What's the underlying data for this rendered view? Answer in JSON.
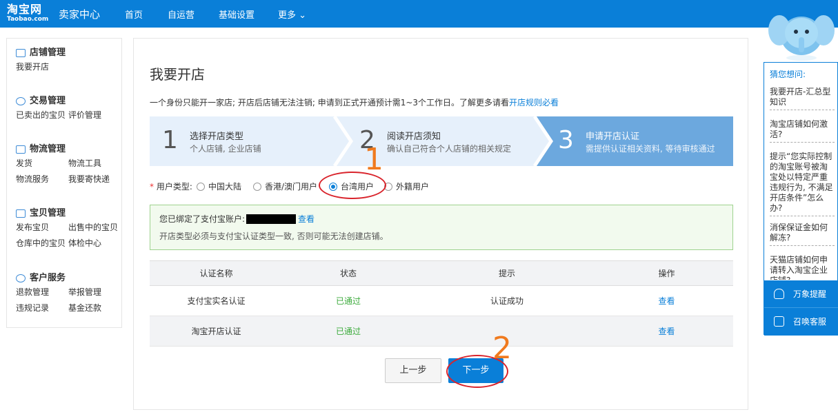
{
  "header": {
    "logo_cn": "淘宝网",
    "logo_en": "Taobao.com",
    "seller_center": "卖家中心",
    "nav": [
      "首页",
      "自运营",
      "基础设置",
      "更多 ⌄"
    ]
  },
  "sidebar": {
    "groups": [
      {
        "title": "店铺管理",
        "icon": "store-icon",
        "items": [
          [
            "我要开店"
          ]
        ]
      },
      {
        "title": "交易管理",
        "icon": "transaction-icon",
        "items": [
          [
            "已卖出的宝贝",
            "评价管理"
          ]
        ]
      },
      {
        "title": "物流管理",
        "icon": "logistics-icon",
        "items": [
          [
            "发货",
            "物流工具"
          ],
          [
            "物流服务",
            "我要寄快递"
          ]
        ]
      },
      {
        "title": "宝贝管理",
        "icon": "goods-icon",
        "items": [
          [
            "发布宝贝",
            "出售中的宝贝"
          ],
          [
            "仓库中的宝贝",
            "体检中心"
          ]
        ]
      },
      {
        "title": "客户服务",
        "icon": "customer-service-icon",
        "items": [
          [
            "退款管理",
            "举报管理"
          ],
          [
            "违规记录",
            "基金还款"
          ]
        ]
      }
    ]
  },
  "main": {
    "title": "我要开店",
    "desc": "一个身份只能开一家店; 开店后店铺无法注销; 申请到正式开通预计需1~3个工作日。了解更多请看",
    "desc_link": "开店规则必看",
    "steps": [
      {
        "num": "1",
        "title": "选择开店类型",
        "sub": "个人店铺, 企业店铺"
      },
      {
        "num": "2",
        "title": "阅读开店须知",
        "sub": "确认自己符合个人店铺的相关规定"
      },
      {
        "num": "3",
        "title": "申请开店认证",
        "sub": "需提供认证相关资料, 等待审核通过"
      }
    ],
    "user_type_label": "用户类型:",
    "user_type_required": "*",
    "user_types": [
      "中国大陆",
      "香港/澳门用户",
      "台湾用户",
      "外籍用户"
    ],
    "user_type_selected": "台湾用户",
    "notice_line1": "您已绑定了支付宝账户:",
    "notice_link": "查看",
    "notice_line2": "开店类型必须与支付宝认证类型一致, 否则可能无法创建店铺。",
    "table": {
      "headers": [
        "认证名称",
        "状态",
        "提示",
        "操作"
      ],
      "rows": [
        [
          "支付宝实名认证",
          "已通过",
          "认证成功",
          "查看"
        ],
        [
          "淘宝开店认证",
          "已通过",
          "",
          "查看"
        ]
      ]
    },
    "prev_label": "上一步",
    "next_label": "下一步"
  },
  "annotations": [
    "1",
    "2"
  ],
  "right_panel": {
    "header": "猜您想问:",
    "faqs": [
      "我要开店-汇总型知识",
      "淘宝店铺如何激活?",
      "提示“您实际控制的淘宝账号被淘宝处以特定严重违规行为, 不满足开店条件”怎么办?",
      "消保保证金如何解冻?",
      "天猫店铺如何申请转入淘宝企业店铺?"
    ],
    "btn_remind": "万象提醒",
    "btn_service": "召唤客服"
  },
  "colors": {
    "brand": "#0a7fd8",
    "success": "#3cab3c",
    "annotation_circle": "#d9232b",
    "annotation_number": "#f07a1e"
  }
}
